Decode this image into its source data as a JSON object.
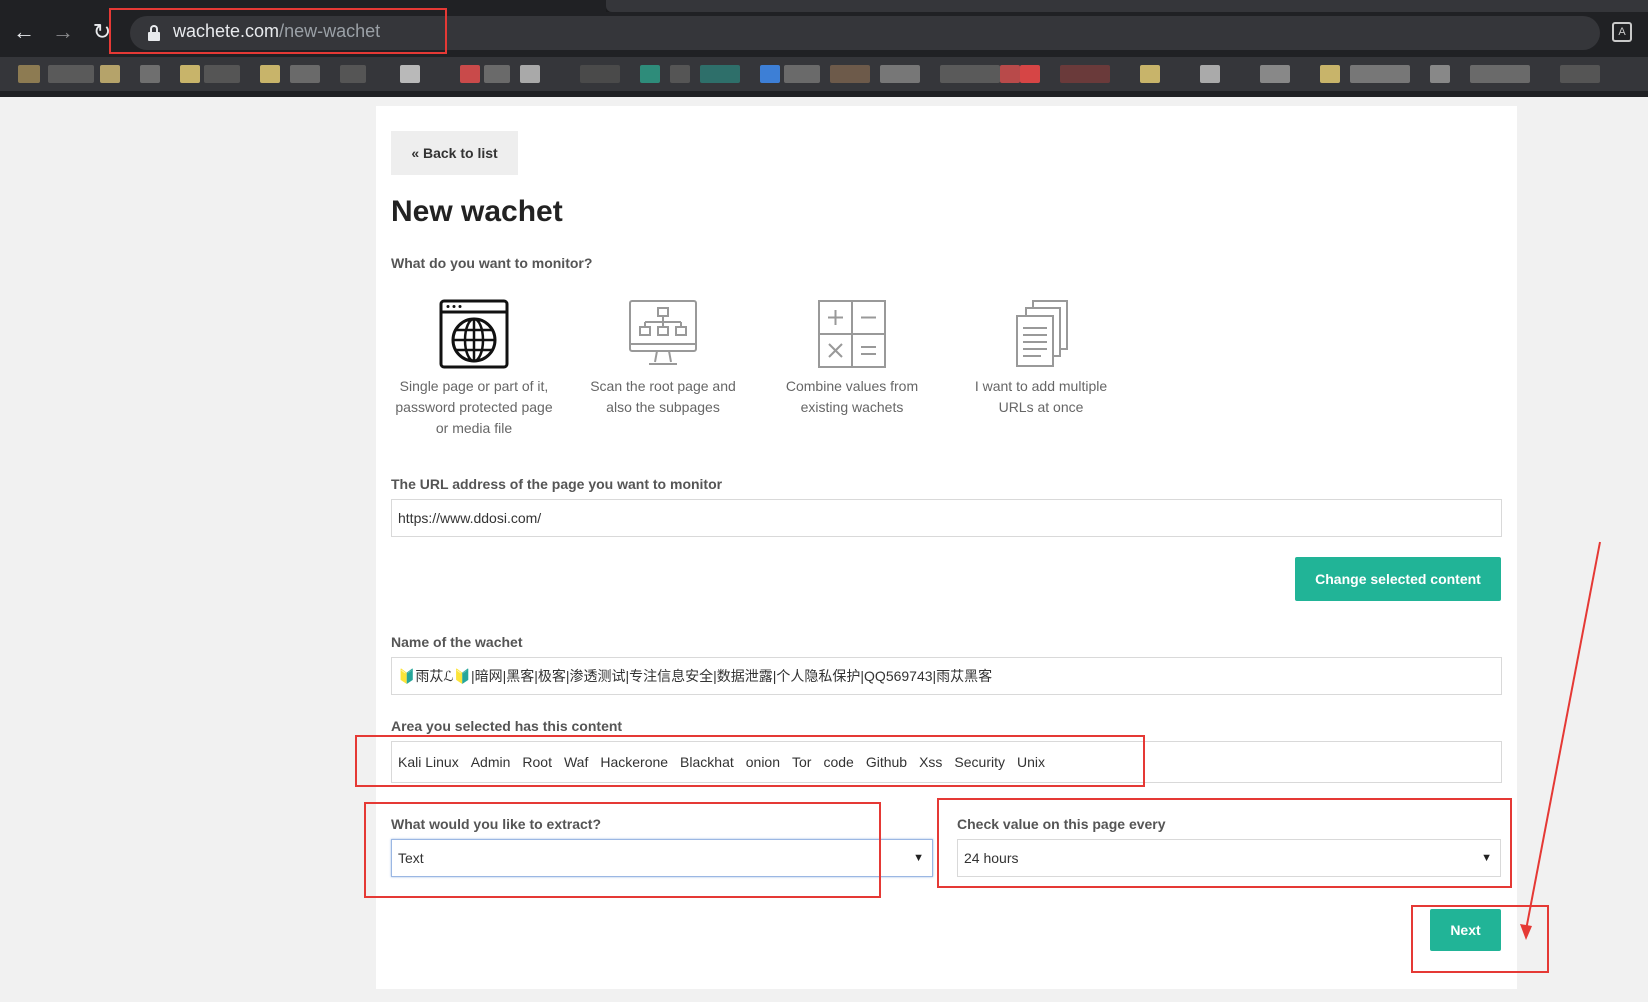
{
  "browser": {
    "url_host": "wachete.com",
    "url_path": "/new-wachet",
    "back_icon": "arrow-left-icon",
    "forward_icon": "arrow-right-icon",
    "reload_icon": "reload-icon",
    "translate_icon": "translate-icon"
  },
  "page": {
    "back_label": "« Back to list",
    "title": "New wachet",
    "monitor_question": "What do you want to monitor?",
    "options": [
      {
        "icon": "globe-browser-icon",
        "label": "Single page or part of it, password protected page or media file"
      },
      {
        "icon": "sitemap-monitor-icon",
        "label": "Scan the root page and also the subpages"
      },
      {
        "icon": "calculator-icon",
        "label": "Combine values from existing wachets"
      },
      {
        "icon": "documents-stack-icon",
        "label": "I want to add multiple URLs at once"
      }
    ],
    "url_label": "The URL address of the page you want to monitor",
    "url_value": "https://www.ddosi.com/",
    "change_content_label": "Change selected content",
    "name_label": "Name of the wachet",
    "name_value": "🔰雨苁ℒ🔰|暗网|黑客|极客|渗透测试|专注信息安全|数据泄露|个人隐私保护|QQ569743|雨苁黑客",
    "area_label": "Area you selected has this content",
    "area_tags": [
      "Kali Linux",
      "Admin",
      "Root",
      "Waf",
      "Hackerone",
      "Blackhat",
      "onion",
      "Tor",
      "code",
      "Github",
      "Xss",
      "Security",
      "Unix"
    ],
    "extract_label": "What would you like to extract?",
    "extract_value": "Text",
    "check_label": "Check value on this page every",
    "check_value": "24 hours",
    "next_label": "Next"
  },
  "colors": {
    "accent": "#21b497",
    "annotation": "#e53935",
    "chrome_bg": "#202124"
  }
}
